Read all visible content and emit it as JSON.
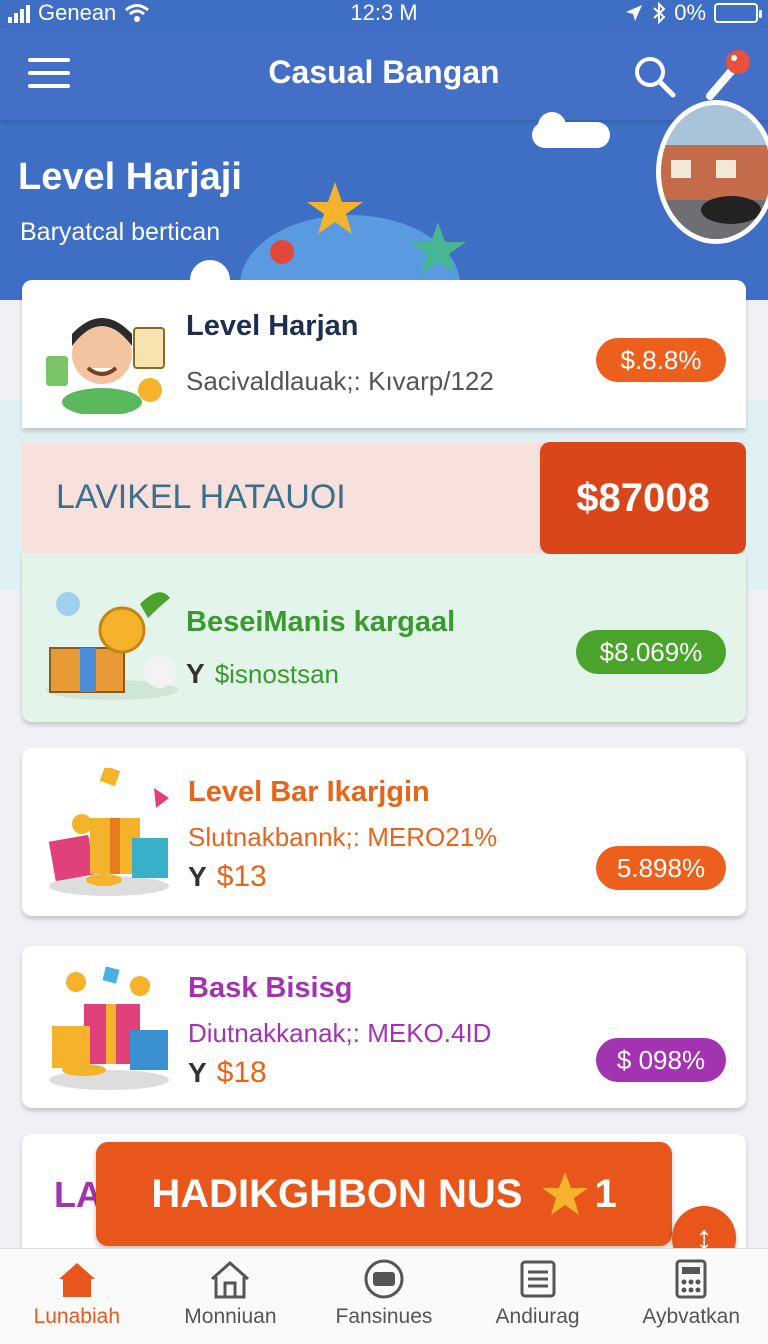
{
  "status": {
    "carrier": "Genean",
    "time": "12:3 M",
    "battery": "0%"
  },
  "header": {
    "title": "Casual Bangan"
  },
  "hero": {
    "title": "Level Harjaji",
    "subtitle": "Baryatcal bertican"
  },
  "cards": [
    {
      "title": "Level Harjan",
      "subtitle": "Sacivaldlauak;: Kıvarp/122",
      "badge": "$.8.8%"
    },
    {
      "title": "BeseiManis kargaal",
      "amount": "$isnostsan",
      "badge": "$8.069%"
    },
    {
      "title": "Level Bar Ikarjgin",
      "subtitle": "Slutnakbannk;: MERO21%",
      "amount": "$13",
      "badge": "5.898%"
    },
    {
      "title": "Bask Bisisg",
      "subtitle": "Diutnakkanak;: MEKO.4ID",
      "amount": "$18",
      "badge": "$ 098%"
    },
    {
      "title": "LA"
    }
  ],
  "banner": {
    "label": "LAVIKEL HATAUOI",
    "price": "$87008"
  },
  "bonus": {
    "label": "HADIKGHBON NUS",
    "count": "1"
  },
  "nav": [
    {
      "label": "Lunabiah"
    },
    {
      "label": "Monniuan"
    },
    {
      "label": "Fansinues"
    },
    {
      "label": "Andiurag"
    },
    {
      "label": "Aybvatkan"
    }
  ],
  "colors": {
    "primary": "#4370c6",
    "accent": "#e8561c",
    "green": "#4aa32b",
    "purple": "#a334b1"
  }
}
